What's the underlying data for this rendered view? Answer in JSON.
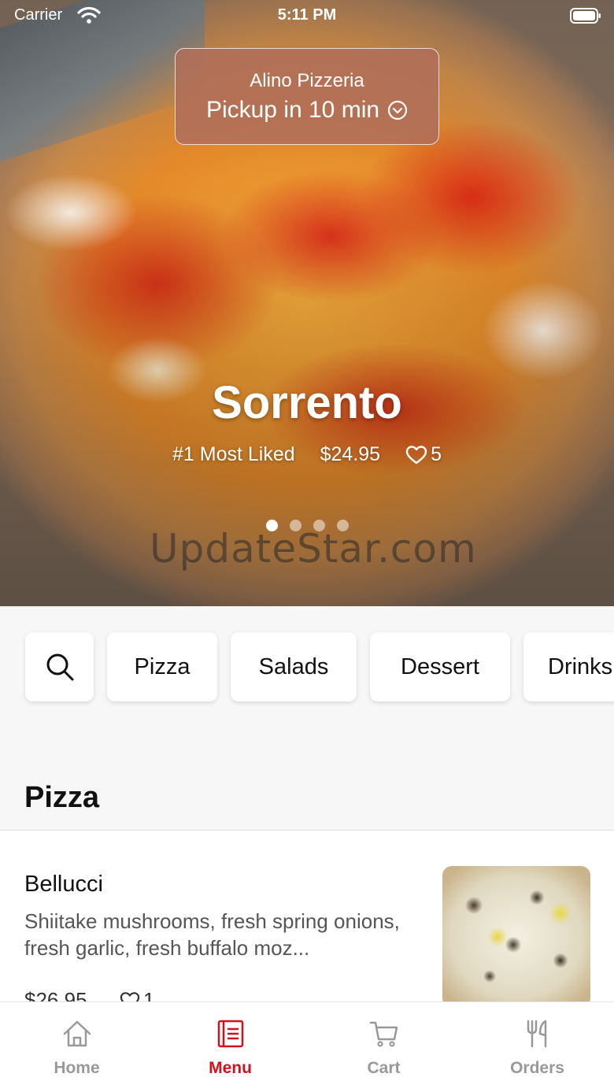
{
  "status_bar": {
    "carrier": "Carrier",
    "time": "5:11 PM"
  },
  "store": {
    "name": "Alino Pizzeria",
    "pickup": "Pickup in 10 min"
  },
  "featured": {
    "title": "Sorrento",
    "rank": "#1 Most Liked",
    "price": "$24.95",
    "likes": "5",
    "page_count": 4,
    "active_page": 1
  },
  "watermark": "UpdateStar.com",
  "categories": [
    "Pizza",
    "Salads",
    "Dessert",
    "Drinks"
  ],
  "section": {
    "title": "Pizza"
  },
  "items": [
    {
      "name": "Bellucci",
      "description": "Shiitake mushrooms, fresh spring onions, fresh garlic, fresh buffalo moz...",
      "price": "$26.95",
      "likes": "1"
    }
  ],
  "tabs": [
    {
      "label": "Home",
      "icon": "home-icon",
      "active": false
    },
    {
      "label": "Menu",
      "icon": "menu-icon",
      "active": true
    },
    {
      "label": "Cart",
      "icon": "cart-icon",
      "active": false
    },
    {
      "label": "Orders",
      "icon": "utensils-icon",
      "active": false
    }
  ],
  "colors": {
    "accent": "#d4101c",
    "inactive_tab": "#999999"
  }
}
